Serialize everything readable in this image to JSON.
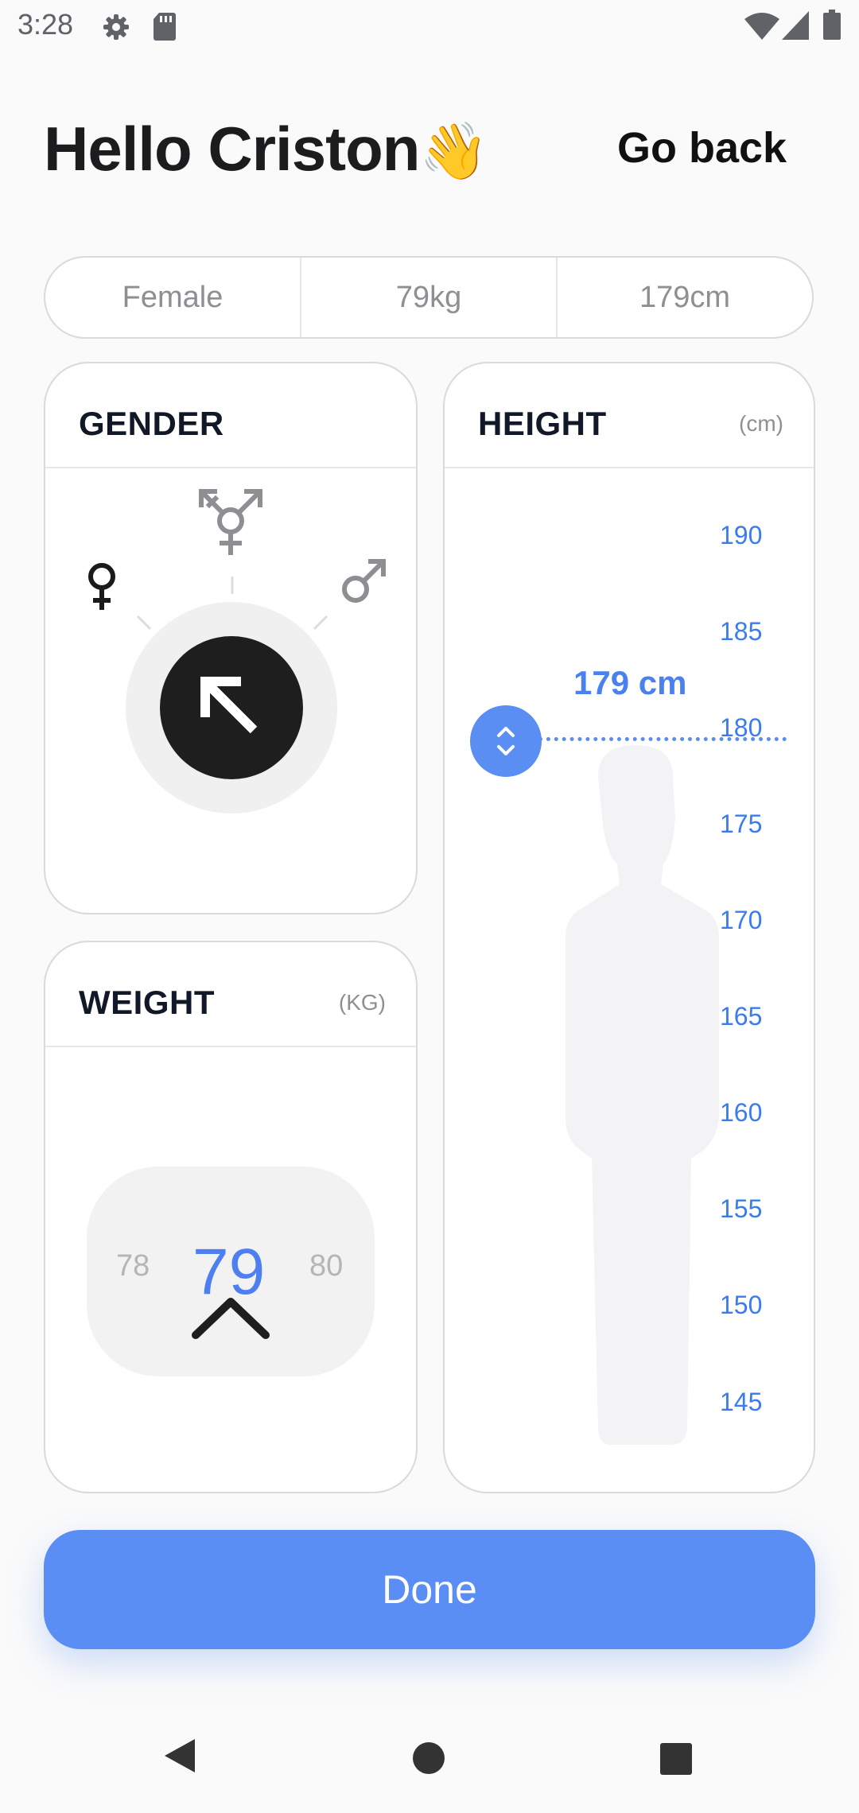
{
  "status_bar": {
    "time": "3:28",
    "icons": [
      "gear-icon",
      "sd-card-icon",
      "wifi-icon",
      "signal-icon",
      "battery-icon"
    ]
  },
  "header": {
    "greeting": "Hello Criston",
    "greeting_emoji": "👋",
    "go_back_label": "Go back"
  },
  "summary": {
    "gender": "Female",
    "weight": "79kg",
    "height": "179cm"
  },
  "gender_card": {
    "title": "GENDER",
    "options": [
      "female-symbol",
      "transgender-symbol",
      "male-symbol"
    ],
    "selected": "female-symbol"
  },
  "weight_card": {
    "title": "WEIGHT",
    "unit": "(KG)",
    "previous": "78",
    "current": "79",
    "next": "80"
  },
  "height_card": {
    "title": "HEIGHT",
    "unit": "(cm)",
    "readout": "179 cm",
    "ticks": [
      "190",
      "185",
      "180",
      "175",
      "170",
      "165",
      "160",
      "155",
      "150",
      "145"
    ]
  },
  "done_label": "Done",
  "colors": {
    "accent": "#5b8ef5",
    "tick_blue": "#3b7bf0",
    "dark": "#1e1e1e"
  }
}
